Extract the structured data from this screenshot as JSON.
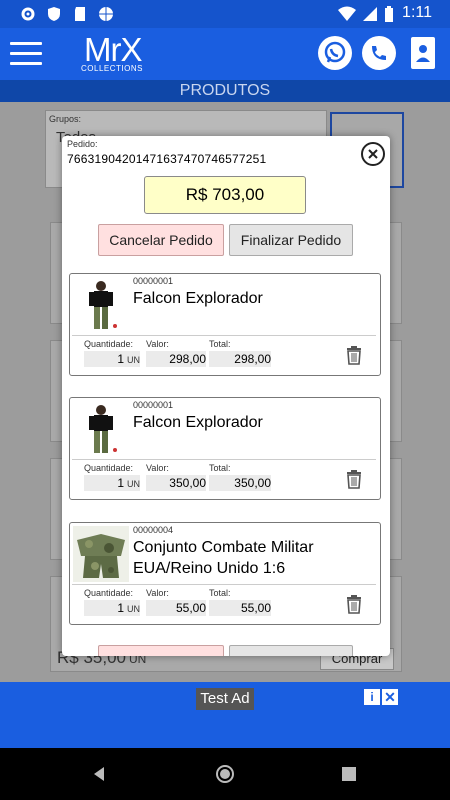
{
  "status_bar": {
    "time": "1:11"
  },
  "app": {
    "logo": "MrX",
    "logo_sub": "COLLECTIONS",
    "page_title": "PRODUTOS"
  },
  "background": {
    "groups_label": "Grupos:",
    "groups_value": "Todos",
    "price": "R$ 35,00",
    "price_unit": "UN",
    "buy_label": "Comprar"
  },
  "order": {
    "label": "Pedido:",
    "number": "76631904201471637470746577251",
    "total": "R$ 703,00",
    "cancel_label": "Cancelar Pedido",
    "finalize_label": "Finalizar Pedido",
    "col_qty": "Quantidade:",
    "col_value": "Valor:",
    "col_total": "Total:",
    "items": [
      {
        "code": "00000001",
        "name": "Falcon Explorador",
        "qty": "1",
        "unit": "UN",
        "value": "298,00",
        "total": "298,00"
      },
      {
        "code": "00000001",
        "name": "Falcon Explorador",
        "qty": "1",
        "unit": "UN",
        "value": "350,00",
        "total": "350,00"
      },
      {
        "code": "00000004",
        "name": "Conjunto Combate Militar EUA/Reino Unido 1:6",
        "qty": "1",
        "unit": "UN",
        "value": "55,00",
        "total": "55,00"
      }
    ]
  },
  "ad": {
    "label": "Test Ad",
    "info": "i",
    "close": "✕"
  },
  "colors": {
    "primary": "#1a5ee0",
    "title_bar": "#0f47a8",
    "total_bg": "#ffffc8",
    "cancel_bg": "#ffe0e0"
  },
  "icons": [
    "hamburger-menu-icon",
    "whatsapp-icon",
    "phone-icon",
    "contact-card-icon",
    "close-icon",
    "trash-icon"
  ]
}
